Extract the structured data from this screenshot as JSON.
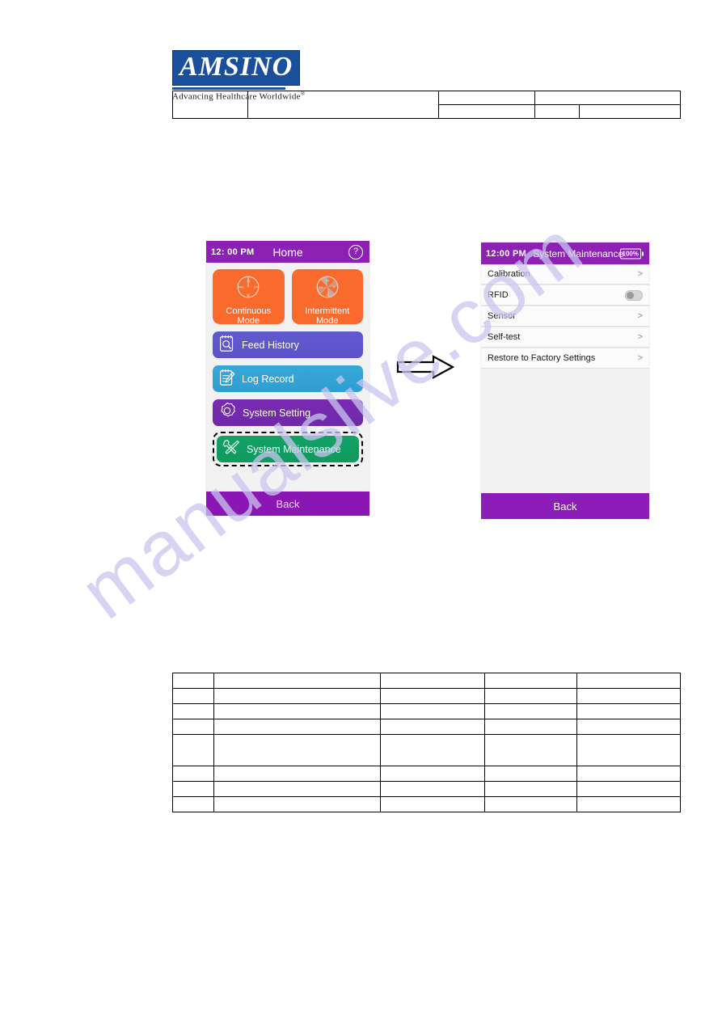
{
  "brand": {
    "logo_word": "AMSINO",
    "tagline": "Advancing Healthcare Worldwide",
    "tagline_mark": "®",
    "logo_color": "#1a4f9c"
  },
  "flow": {
    "arrow": "right-arrow"
  },
  "watermark": {
    "text": "manualslive.com",
    "color": "#c9c6ee"
  },
  "home_screen": {
    "status": {
      "time": "12: 00 PM",
      "title": "Home",
      "help_icon_label": "?"
    },
    "modes": [
      {
        "label_line1": "Continuous",
        "label_line2": "Mode",
        "icon": "clock-icon",
        "color": "#f96a2c"
      },
      {
        "label_line1": "Intermittent",
        "label_line2": "Mode",
        "icon": "clock-segments-icon",
        "color": "#f96a2c"
      }
    ],
    "tiles": [
      {
        "label": "Feed History",
        "icon": "notepad-search-icon",
        "color": "#6259cf",
        "highlighted": false
      },
      {
        "label": "Log Record",
        "icon": "notepad-pencil-icon",
        "color": "#36a7d8",
        "highlighted": false
      },
      {
        "label": "System Setting",
        "icon": "gear-icon",
        "color": "#7a2ab3",
        "highlighted": false
      },
      {
        "label": "System Maintenance",
        "icon": "wrench-screwdriver-icon",
        "color": "#12a164",
        "highlighted": true
      }
    ],
    "back_label": "Back"
  },
  "maintenance_screen": {
    "status": {
      "time": "12:00 PM",
      "title": "System Maintenance",
      "battery": "100%"
    },
    "rows": [
      {
        "label": "Calibration",
        "control": "chevron",
        "chevron": ">"
      },
      {
        "label": "RFID",
        "control": "toggle",
        "toggle_on": false
      },
      {
        "label": "Sensor",
        "control": "chevron",
        "chevron": ">"
      },
      {
        "label": "Self-test",
        "control": "chevron",
        "chevron": ">"
      },
      {
        "label": "Restore to Factory Settings",
        "control": "chevron",
        "chevron": ">"
      }
    ],
    "back_label": "Back"
  },
  "top_table": {
    "rows": 2,
    "cells": [
      [
        "",
        "",
        "",
        ""
      ],
      [
        "",
        "",
        "",
        ""
      ]
    ]
  },
  "bottom_table": {
    "rows": 8,
    "cells": [
      [
        "",
        "",
        "",
        ""
      ],
      [
        "",
        "",
        "",
        ""
      ],
      [
        "",
        "",
        "",
        ""
      ],
      [
        "",
        "",
        "",
        ""
      ],
      [
        "",
        "",
        "",
        ""
      ],
      [
        "",
        "",
        "",
        ""
      ],
      [
        "",
        "",
        "",
        ""
      ],
      [
        "",
        "",
        "",
        ""
      ]
    ]
  }
}
